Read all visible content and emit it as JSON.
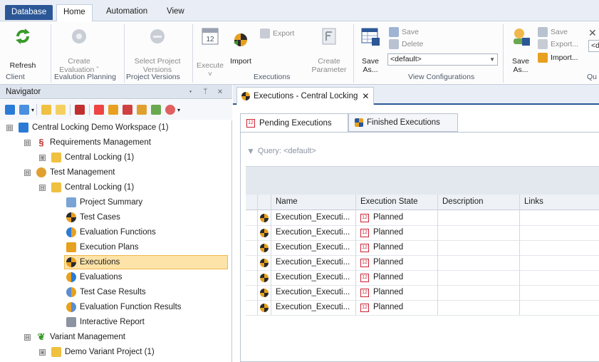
{
  "ribbon_tabs": {
    "database": "Database",
    "home": "Home",
    "automation": "Automation",
    "view": "View"
  },
  "ribbon": {
    "refresh": "Refresh",
    "create_evaluation": [
      "Create",
      "Evaluation ˇ"
    ],
    "select_project_versions": [
      "Select Project",
      "Versions"
    ],
    "execute": "Execute",
    "execute_arrow": "˅",
    "import": "Import",
    "export": "Export",
    "create_parameter": [
      "Create",
      "Parameter"
    ],
    "save_as": [
      "Save",
      "As..."
    ],
    "save": "Save",
    "delete": "Delete",
    "view_config_value": "<default>",
    "save_as_2": [
      "Save",
      "As..."
    ],
    "save_2": "Save",
    "export_2": "Export...",
    "import_2": "Import...",
    "right_dropdown_value": "<d",
    "groups": {
      "client": "Client",
      "evaluation_planning": "Evalution Planning",
      "project_versions": "Project Versions",
      "executions": "Executions",
      "view_configurations": "View Configurations",
      "qu": "Qu"
    }
  },
  "navigator": {
    "title": "Navigator",
    "controls": "▾ ᛘ ✕",
    "tree": [
      {
        "label": "Central Locking Demo Workspace (1)",
        "level": 0,
        "expander": "⊟",
        "icon": "workspace-icon"
      },
      {
        "label": "Requirements Management",
        "level": 1,
        "expander": "⊟",
        "icon": "requirements-icon"
      },
      {
        "label": "Central Locking (1)",
        "level": 2,
        "expander": "⊞",
        "icon": "requirements-project-icon"
      },
      {
        "label": "Test Management",
        "level": 1,
        "expander": "⊟",
        "icon": "test-management-icon"
      },
      {
        "label": "Central Locking (1)",
        "level": 2,
        "expander": "⊟",
        "icon": "test-project-icon"
      },
      {
        "label": "Project Summary",
        "level": 3,
        "expander": "",
        "icon": "project-summary-icon"
      },
      {
        "label": "Test Cases",
        "level": 3,
        "expander": "",
        "icon": "test-cases-icon"
      },
      {
        "label": "Evaluation Functions",
        "level": 3,
        "expander": "",
        "icon": "evaluation-functions-icon"
      },
      {
        "label": "Execution Plans",
        "level": 3,
        "expander": "",
        "icon": "execution-plans-icon"
      },
      {
        "label": "Executions",
        "level": 3,
        "expander": "",
        "icon": "executions-icon",
        "selected": true
      },
      {
        "label": "Evaluations",
        "level": 3,
        "expander": "",
        "icon": "evaluations-icon"
      },
      {
        "label": "Test Case Results",
        "level": 3,
        "expander": "",
        "icon": "test-case-results-icon"
      },
      {
        "label": "Evaluation Function Results",
        "level": 3,
        "expander": "",
        "icon": "evaluation-function-results-icon"
      },
      {
        "label": "Interactive Report",
        "level": 3,
        "expander": "",
        "icon": "interactive-report-icon"
      },
      {
        "label": "Variant Management",
        "level": 1,
        "expander": "⊟",
        "icon": "variant-management-icon"
      },
      {
        "label": "Demo Variant Project (1)",
        "level": 2,
        "expander": "⊞",
        "icon": "variant-project-icon"
      }
    ]
  },
  "document": {
    "tab_label": "Executions - Central Locking",
    "close": "✕",
    "subtabs": {
      "pending": "Pending Executions",
      "finished": "Finished Executions"
    },
    "query": "Query: <default>",
    "columns": [
      "Name",
      "Execution State",
      "Description",
      "Links"
    ],
    "rows": [
      {
        "name": "Execution_Executi...",
        "state": "Planned",
        "description": "",
        "links": ""
      },
      {
        "name": "Execution_Executi...",
        "state": "Planned",
        "description": "",
        "links": ""
      },
      {
        "name": "Execution_Executi...",
        "state": "Planned",
        "description": "",
        "links": ""
      },
      {
        "name": "Execution_Executi...",
        "state": "Planned",
        "description": "",
        "links": ""
      },
      {
        "name": "Execution_Executi...",
        "state": "Planned",
        "description": "",
        "links": ""
      },
      {
        "name": "Execution_Executi...",
        "state": "Planned",
        "description": "",
        "links": ""
      },
      {
        "name": "Execution_Executi...",
        "state": "Planned",
        "description": "",
        "links": ""
      }
    ]
  },
  "colors": {
    "accent": "#2b5797",
    "selection": "#fde3a7",
    "planned_icon": "#cc2233"
  }
}
